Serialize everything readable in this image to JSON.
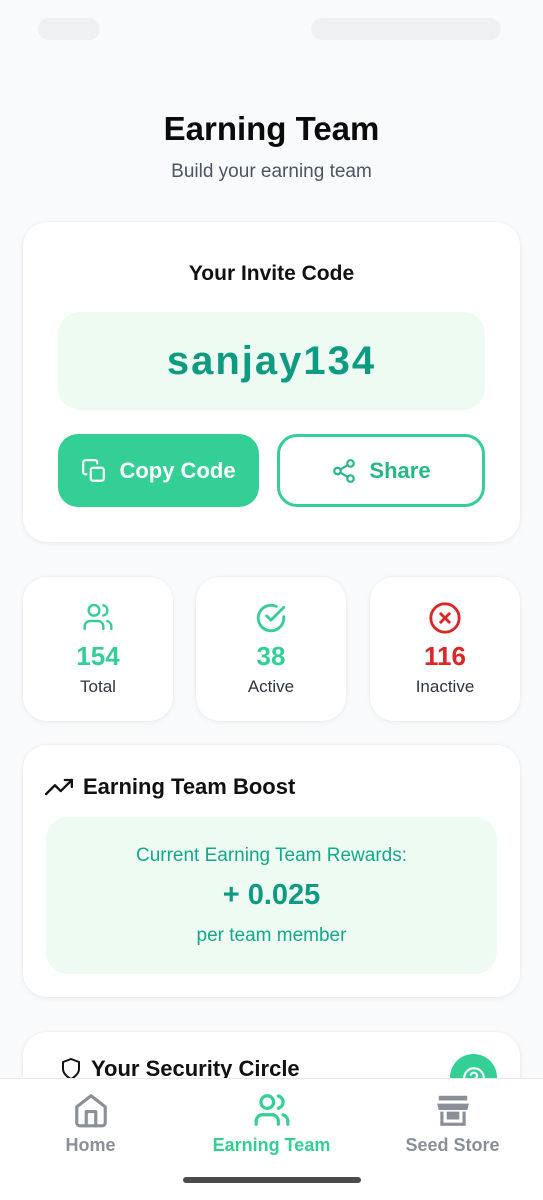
{
  "header": {
    "title": "Earning Team",
    "subtitle": "Build your earning team"
  },
  "invite": {
    "label": "Your Invite Code",
    "code": "sanjay134",
    "copy_label": "Copy Code",
    "share_label": "Share"
  },
  "stats": [
    {
      "value": "154",
      "label": "Total",
      "icon": "users-icon",
      "color": "#34cf95"
    },
    {
      "value": "38",
      "label": "Active",
      "icon": "check-circle-icon",
      "color": "#34cf95"
    },
    {
      "value": "116",
      "label": "Inactive",
      "icon": "x-circle-icon",
      "color": "#dc2626"
    }
  ],
  "boost": {
    "title": "Earning Team Boost",
    "rewards_label": "Current Earning Team Rewards:",
    "rewards_value": "+ 0.025",
    "rewards_unit": "per team member"
  },
  "security": {
    "title": "Your Security Circle"
  },
  "nav": [
    {
      "label": "Home",
      "icon": "home-icon",
      "active": false
    },
    {
      "label": "Earning Team",
      "icon": "users-icon",
      "active": true
    },
    {
      "label": "Seed Store",
      "icon": "store-icon",
      "active": false
    }
  ],
  "colors": {
    "accent": "#34cf95",
    "accent_dark": "#0f9b82",
    "danger": "#dc2626",
    "soft_green": "#eefbf3"
  }
}
